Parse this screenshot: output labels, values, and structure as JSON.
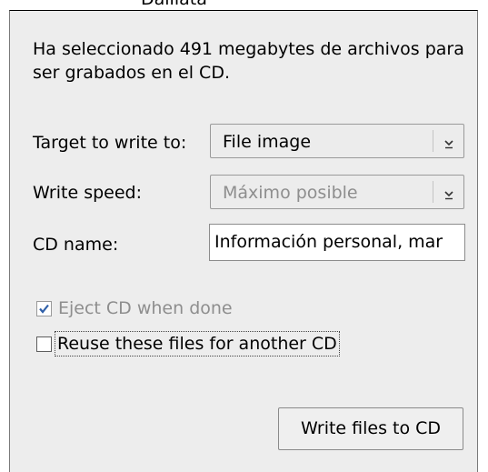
{
  "window": {
    "title_fragment": "Dalilata"
  },
  "dialog": {
    "intro_text": "Ha seleccionado 491 megabytes de archivos para ser grabados en el CD.",
    "target": {
      "label": "Target to write to:",
      "value": "File image",
      "icon": "chevron-down-icon"
    },
    "speed": {
      "label": "Write speed:",
      "value": "Máximo posible",
      "icon": "chevron-down-icon"
    },
    "cd_name": {
      "label": "CD name:",
      "value": "Información personal, mar"
    },
    "eject": {
      "label": "Eject CD when done",
      "checked": true
    },
    "reuse": {
      "label": "Reuse these files for another CD",
      "checked": false
    },
    "write_button": "Write files to CD"
  },
  "colors": {
    "dialog_bg": "#ededed",
    "check_mark": "#2f5fa8",
    "disabled_text": "#8e8e8e"
  }
}
